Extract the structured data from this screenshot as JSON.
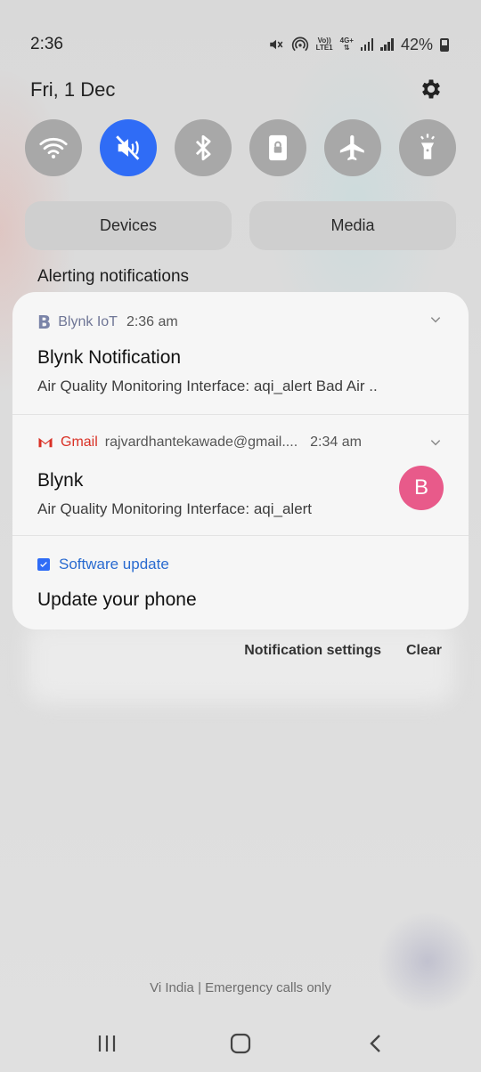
{
  "status_bar": {
    "time": "2:36",
    "network_top": "Vo))",
    "network_bottom": "LTE1",
    "data_type": "4G+",
    "battery": "42%"
  },
  "header": {
    "date": "Fri, 1 Dec"
  },
  "quick_settings": {
    "toggles": [
      {
        "name": "wifi",
        "icon": "wifi-icon",
        "on": false
      },
      {
        "name": "sound",
        "icon": "mute-icon",
        "on": true
      },
      {
        "name": "bluetooth",
        "icon": "bluetooth-icon",
        "on": false
      },
      {
        "name": "rotation-lock",
        "icon": "portrait-lock-icon",
        "on": false
      },
      {
        "name": "airplane",
        "icon": "airplane-icon",
        "on": false
      },
      {
        "name": "flashlight",
        "icon": "flashlight-icon",
        "on": false
      }
    ],
    "devices_label": "Devices",
    "media_label": "Media"
  },
  "section_title": "Alerting notifications",
  "notifications": [
    {
      "app": "Blynk IoT",
      "time": "2:36 am",
      "title": "Blynk Notification",
      "body": "Air Quality Monitoring Interface: aqi_alert Bad Air .."
    },
    {
      "app": "Gmail",
      "account": "rajvardhantekawade@gmail....",
      "time": "2:34 am",
      "title": "Blynk",
      "body": "Air Quality Monitoring Interface: aqi_alert",
      "avatar_letter": "B"
    },
    {
      "app": "Software update",
      "title": "Update your phone"
    }
  ],
  "actions": {
    "settings_label": "Notification settings",
    "clear_label": "Clear"
  },
  "carrier_text": "Vi India | Emergency calls only",
  "colors": {
    "accent": "#2f6cf6",
    "gmail": "#d93025",
    "avatar": "#e85a8a"
  }
}
